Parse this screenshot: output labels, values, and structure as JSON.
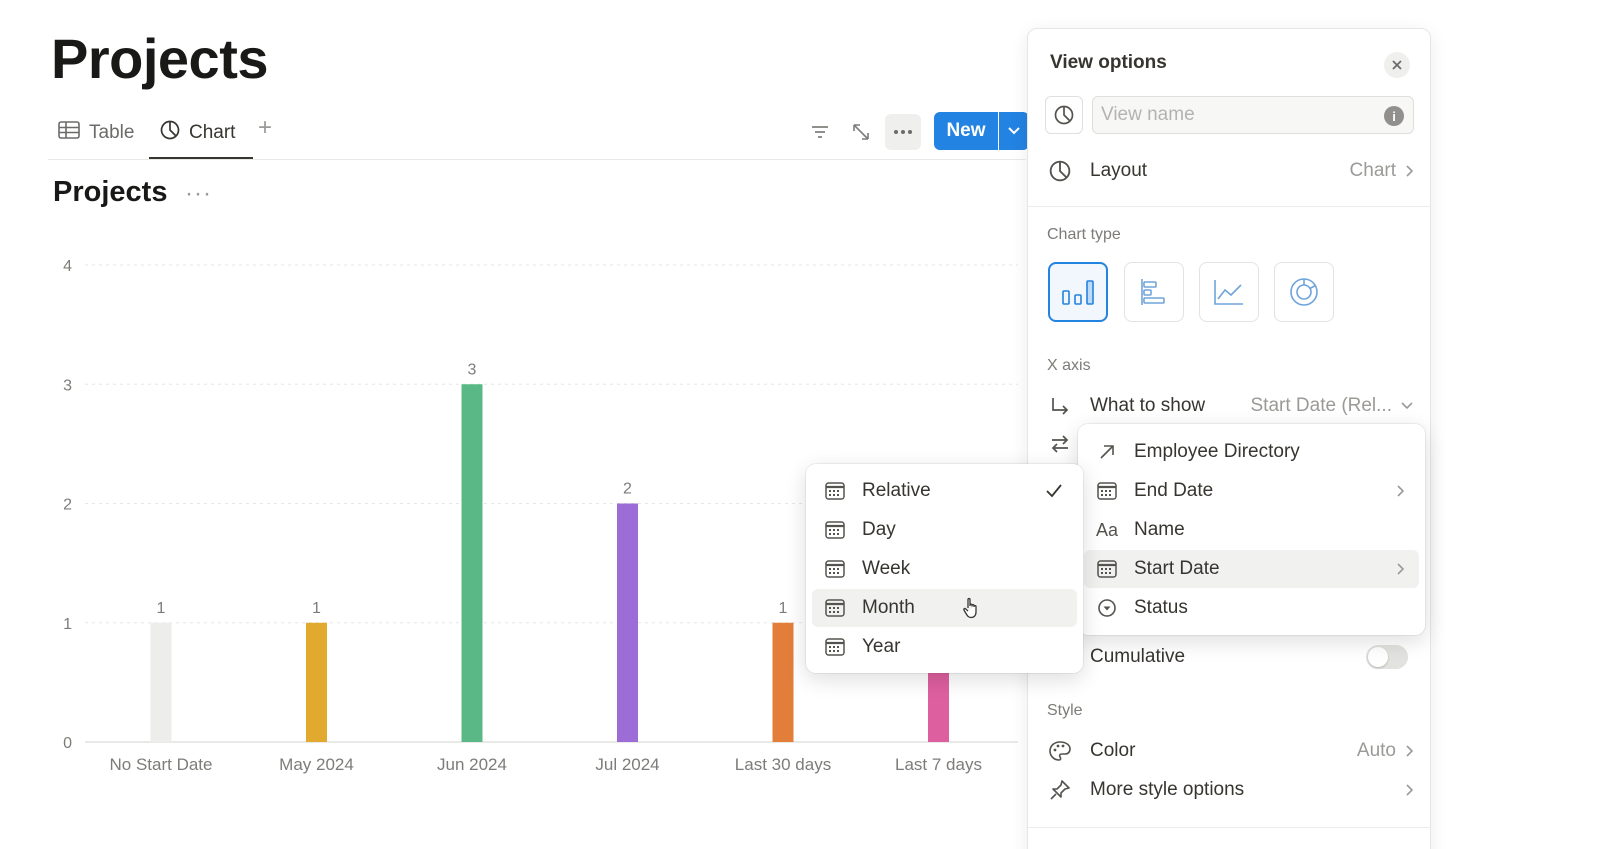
{
  "page": {
    "title": "Projects"
  },
  "tabs": [
    {
      "label": "Table",
      "icon": "table-icon",
      "active": false
    },
    {
      "label": "Chart",
      "icon": "chart-pie-icon",
      "active": true
    }
  ],
  "toolbar": {
    "new_label": "New"
  },
  "chart_header": {
    "title": "Projects"
  },
  "chart_data": {
    "type": "bar",
    "title": "",
    "xlabel": "",
    "ylabel": "",
    "categories": [
      "No Start Date",
      "May 2024",
      "Jun 2024",
      "Jul 2024",
      "Last 30 days",
      "Last 7 days"
    ],
    "values": [
      1,
      1,
      3,
      2,
      1,
      1
    ],
    "value_labels": [
      "1",
      "1",
      "3",
      "2",
      "1",
      ""
    ],
    "colors": [
      "#ededeb",
      "#e2a92f",
      "#59b886",
      "#9c6dd6",
      "#e37e3a",
      "#dd5f9f"
    ],
    "ylim": [
      0,
      4
    ],
    "yticks": [
      "0",
      "1",
      "2",
      "3",
      "4"
    ],
    "grid": true
  },
  "view_options": {
    "title": "View options",
    "view_name_placeholder": "View name",
    "layout": {
      "label": "Layout",
      "value": "Chart"
    },
    "chart_type": {
      "section_label": "Chart type",
      "options": [
        {
          "name": "vertical-bar",
          "selected": true
        },
        {
          "name": "horizontal-bar",
          "selected": false
        },
        {
          "name": "line",
          "selected": false
        },
        {
          "name": "donut",
          "selected": false
        }
      ]
    },
    "x_axis": {
      "section_label": "X axis",
      "what_to_show_label": "What to show",
      "what_to_show_value": "Start Date (Rel..."
    },
    "cumulative_label": "Cumulative",
    "cumulative_on": false,
    "style": {
      "section_label": "Style",
      "color_label": "Color",
      "color_value": "Auto",
      "more_label": "More style options"
    }
  },
  "field_menu": {
    "items": [
      {
        "label": "Employee Directory",
        "icon": "arrow-up-right-icon",
        "has_submenu": false,
        "highlighted": false
      },
      {
        "label": "End Date",
        "icon": "calendar-icon",
        "has_submenu": true,
        "highlighted": false
      },
      {
        "label": "Name",
        "icon": "text-aa-icon",
        "has_submenu": false,
        "highlighted": false
      },
      {
        "label": "Start Date",
        "icon": "calendar-icon",
        "has_submenu": true,
        "highlighted": true
      },
      {
        "label": "Status",
        "icon": "status-icon",
        "has_submenu": false,
        "highlighted": false
      }
    ]
  },
  "granularity_menu": {
    "items": [
      {
        "label": "Relative",
        "checked": true
      },
      {
        "label": "Day",
        "checked": false
      },
      {
        "label": "Week",
        "checked": false
      },
      {
        "label": "Month",
        "checked": false,
        "hovered": true
      },
      {
        "label": "Year",
        "checked": false
      }
    ]
  }
}
